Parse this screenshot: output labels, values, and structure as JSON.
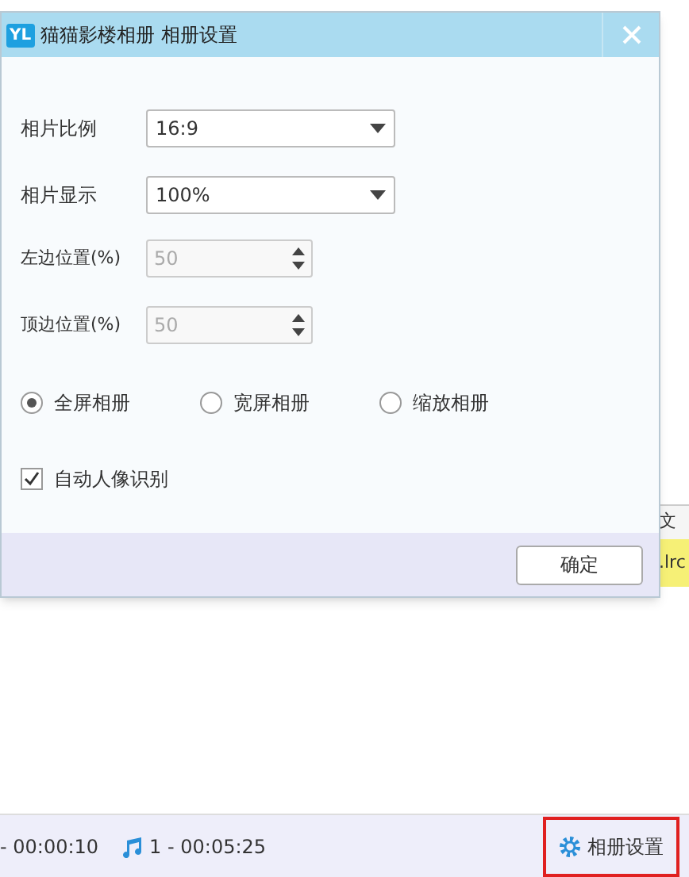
{
  "dialog": {
    "logo": "YL",
    "title": "猫猫影楼相册 相册设置",
    "selects": [
      {
        "label": "相片比例",
        "value": "16:9"
      },
      {
        "label": "相片显示",
        "value": "100%"
      }
    ],
    "spinners": [
      {
        "label": "左边位置(%)",
        "value": "50",
        "disabled": true
      },
      {
        "label": "顶边位置(%)",
        "value": "50",
        "disabled": true
      }
    ],
    "radios": [
      {
        "label": "全屏相册",
        "selected": true
      },
      {
        "label": "宽屏相册",
        "selected": false
      },
      {
        "label": "缩放相册",
        "selected": false
      }
    ],
    "checkbox": {
      "label": "自动人像识别",
      "checked": true
    },
    "ok_button": "确定"
  },
  "background": {
    "column_header": "文",
    "row_cell": ".lrc"
  },
  "status_bar": {
    "video_time": "- 00:00:10",
    "music_time": "1 - 00:05:25",
    "settings_button": {
      "label": "相册设置",
      "highlighted": true
    }
  }
}
